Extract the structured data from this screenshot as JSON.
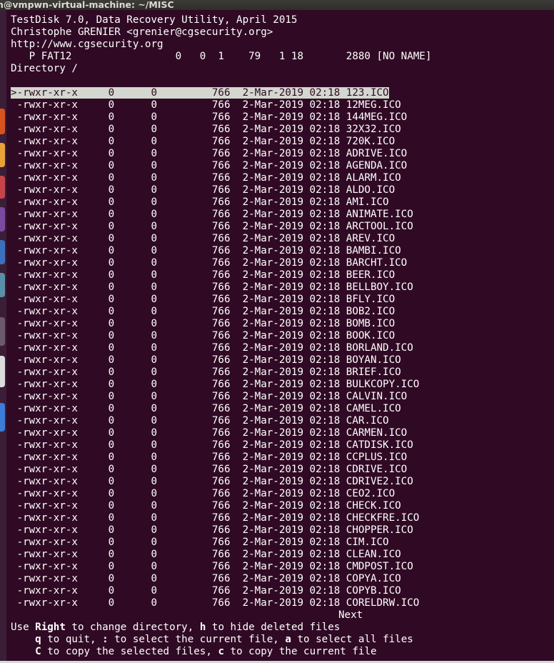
{
  "window": {
    "title": "n@vmpwn-virtual-machine: ~/MISC"
  },
  "header": {
    "line1": "TestDisk 7.0, Data Recovery Utility, April 2015",
    "line2": "Christophe GRENIER <grenier@cgsecurity.org>",
    "line3": "http://www.cgsecurity.org",
    "partition": "   P FAT12                 0   0  1    79   1 18       2880 [NO NAME]",
    "directory": "Directory /"
  },
  "files": [
    {
      "perm": "-rwxr-xr-x",
      "uid": "0",
      "gid": "0",
      "size": "766",
      "date": "2-Mar-2019 02:18",
      "name": "123.ICO"
    },
    {
      "perm": "-rwxr-xr-x",
      "uid": "0",
      "gid": "0",
      "size": "766",
      "date": "2-Mar-2019 02:18",
      "name": "12MEG.ICO"
    },
    {
      "perm": "-rwxr-xr-x",
      "uid": "0",
      "gid": "0",
      "size": "766",
      "date": "2-Mar-2019 02:18",
      "name": "144MEG.ICO"
    },
    {
      "perm": "-rwxr-xr-x",
      "uid": "0",
      "gid": "0",
      "size": "766",
      "date": "2-Mar-2019 02:18",
      "name": "32X32.ICO"
    },
    {
      "perm": "-rwxr-xr-x",
      "uid": "0",
      "gid": "0",
      "size": "766",
      "date": "2-Mar-2019 02:18",
      "name": "720K.ICO"
    },
    {
      "perm": "-rwxr-xr-x",
      "uid": "0",
      "gid": "0",
      "size": "766",
      "date": "2-Mar-2019 02:18",
      "name": "ADRIVE.ICO"
    },
    {
      "perm": "-rwxr-xr-x",
      "uid": "0",
      "gid": "0",
      "size": "766",
      "date": "2-Mar-2019 02:18",
      "name": "AGENDA.ICO"
    },
    {
      "perm": "-rwxr-xr-x",
      "uid": "0",
      "gid": "0",
      "size": "766",
      "date": "2-Mar-2019 02:18",
      "name": "ALARM.ICO"
    },
    {
      "perm": "-rwxr-xr-x",
      "uid": "0",
      "gid": "0",
      "size": "766",
      "date": "2-Mar-2019 02:18",
      "name": "ALDO.ICO"
    },
    {
      "perm": "-rwxr-xr-x",
      "uid": "0",
      "gid": "0",
      "size": "766",
      "date": "2-Mar-2019 02:18",
      "name": "AMI.ICO"
    },
    {
      "perm": "-rwxr-xr-x",
      "uid": "0",
      "gid": "0",
      "size": "766",
      "date": "2-Mar-2019 02:18",
      "name": "ANIMATE.ICO"
    },
    {
      "perm": "-rwxr-xr-x",
      "uid": "0",
      "gid": "0",
      "size": "766",
      "date": "2-Mar-2019 02:18",
      "name": "ARCTOOL.ICO"
    },
    {
      "perm": "-rwxr-xr-x",
      "uid": "0",
      "gid": "0",
      "size": "766",
      "date": "2-Mar-2019 02:18",
      "name": "AREV.ICO"
    },
    {
      "perm": "-rwxr-xr-x",
      "uid": "0",
      "gid": "0",
      "size": "766",
      "date": "2-Mar-2019 02:18",
      "name": "BAMBI.ICO"
    },
    {
      "perm": "-rwxr-xr-x",
      "uid": "0",
      "gid": "0",
      "size": "766",
      "date": "2-Mar-2019 02:18",
      "name": "BARCHT.ICO"
    },
    {
      "perm": "-rwxr-xr-x",
      "uid": "0",
      "gid": "0",
      "size": "766",
      "date": "2-Mar-2019 02:18",
      "name": "BEER.ICO"
    },
    {
      "perm": "-rwxr-xr-x",
      "uid": "0",
      "gid": "0",
      "size": "766",
      "date": "2-Mar-2019 02:18",
      "name": "BELLBOY.ICO"
    },
    {
      "perm": "-rwxr-xr-x",
      "uid": "0",
      "gid": "0",
      "size": "766",
      "date": "2-Mar-2019 02:18",
      "name": "BFLY.ICO"
    },
    {
      "perm": "-rwxr-xr-x",
      "uid": "0",
      "gid": "0",
      "size": "766",
      "date": "2-Mar-2019 02:18",
      "name": "BOB2.ICO"
    },
    {
      "perm": "-rwxr-xr-x",
      "uid": "0",
      "gid": "0",
      "size": "766",
      "date": "2-Mar-2019 02:18",
      "name": "BOMB.ICO"
    },
    {
      "perm": "-rwxr-xr-x",
      "uid": "0",
      "gid": "0",
      "size": "766",
      "date": "2-Mar-2019 02:18",
      "name": "BOOK.ICO"
    },
    {
      "perm": "-rwxr-xr-x",
      "uid": "0",
      "gid": "0",
      "size": "766",
      "date": "2-Mar-2019 02:18",
      "name": "BORLAND.ICO"
    },
    {
      "perm": "-rwxr-xr-x",
      "uid": "0",
      "gid": "0",
      "size": "766",
      "date": "2-Mar-2019 02:18",
      "name": "BOYAN.ICO"
    },
    {
      "perm": "-rwxr-xr-x",
      "uid": "0",
      "gid": "0",
      "size": "766",
      "date": "2-Mar-2019 02:18",
      "name": "BRIEF.ICO"
    },
    {
      "perm": "-rwxr-xr-x",
      "uid": "0",
      "gid": "0",
      "size": "766",
      "date": "2-Mar-2019 02:18",
      "name": "BULKCOPY.ICO"
    },
    {
      "perm": "-rwxr-xr-x",
      "uid": "0",
      "gid": "0",
      "size": "766",
      "date": "2-Mar-2019 02:18",
      "name": "CALVIN.ICO"
    },
    {
      "perm": "-rwxr-xr-x",
      "uid": "0",
      "gid": "0",
      "size": "766",
      "date": "2-Mar-2019 02:18",
      "name": "CAMEL.ICO"
    },
    {
      "perm": "-rwxr-xr-x",
      "uid": "0",
      "gid": "0",
      "size": "766",
      "date": "2-Mar-2019 02:18",
      "name": "CAR.ICO"
    },
    {
      "perm": "-rwxr-xr-x",
      "uid": "0",
      "gid": "0",
      "size": "766",
      "date": "2-Mar-2019 02:18",
      "name": "CARMEN.ICO"
    },
    {
      "perm": "-rwxr-xr-x",
      "uid": "0",
      "gid": "0",
      "size": "766",
      "date": "2-Mar-2019 02:18",
      "name": "CATDISK.ICO"
    },
    {
      "perm": "-rwxr-xr-x",
      "uid": "0",
      "gid": "0",
      "size": "766",
      "date": "2-Mar-2019 02:18",
      "name": "CCPLUS.ICO"
    },
    {
      "perm": "-rwxr-xr-x",
      "uid": "0",
      "gid": "0",
      "size": "766",
      "date": "2-Mar-2019 02:18",
      "name": "CDRIVE.ICO"
    },
    {
      "perm": "-rwxr-xr-x",
      "uid": "0",
      "gid": "0",
      "size": "766",
      "date": "2-Mar-2019 02:18",
      "name": "CDRIVE2.ICO"
    },
    {
      "perm": "-rwxr-xr-x",
      "uid": "0",
      "gid": "0",
      "size": "766",
      "date": "2-Mar-2019 02:18",
      "name": "CEO2.ICO"
    },
    {
      "perm": "-rwxr-xr-x",
      "uid": "0",
      "gid": "0",
      "size": "766",
      "date": "2-Mar-2019 02:18",
      "name": "CHECK.ICO"
    },
    {
      "perm": "-rwxr-xr-x",
      "uid": "0",
      "gid": "0",
      "size": "766",
      "date": "2-Mar-2019 02:18",
      "name": "CHECKFRE.ICO"
    },
    {
      "perm": "-rwxr-xr-x",
      "uid": "0",
      "gid": "0",
      "size": "766",
      "date": "2-Mar-2019 02:18",
      "name": "CHOPPER.ICO"
    },
    {
      "perm": "-rwxr-xr-x",
      "uid": "0",
      "gid": "0",
      "size": "766",
      "date": "2-Mar-2019 02:18",
      "name": "CIM.ICO"
    },
    {
      "perm": "-rwxr-xr-x",
      "uid": "0",
      "gid": "0",
      "size": "766",
      "date": "2-Mar-2019 02:18",
      "name": "CLEAN.ICO"
    },
    {
      "perm": "-rwxr-xr-x",
      "uid": "0",
      "gid": "0",
      "size": "766",
      "date": "2-Mar-2019 02:18",
      "name": "CMDPOST.ICO"
    },
    {
      "perm": "-rwxr-xr-x",
      "uid": "0",
      "gid": "0",
      "size": "766",
      "date": "2-Mar-2019 02:18",
      "name": "COPYA.ICO"
    },
    {
      "perm": "-rwxr-xr-x",
      "uid": "0",
      "gid": "0",
      "size": "766",
      "date": "2-Mar-2019 02:18",
      "name": "COPYB.ICO"
    },
    {
      "perm": "-rwxr-xr-x",
      "uid": "0",
      "gid": "0",
      "size": "766",
      "date": "2-Mar-2019 02:18",
      "name": "CORELDRW.ICO"
    }
  ],
  "selected_index": 0,
  "selection_marker": ">",
  "next_label": "Next",
  "help": {
    "line1": [
      {
        "t": "Use ",
        "b": false
      },
      {
        "t": "Right",
        "b": true
      },
      {
        "t": " to change directory, ",
        "b": false
      },
      {
        "t": "h",
        "b": true
      },
      {
        "t": " to hide deleted files",
        "b": false
      }
    ],
    "line2": [
      {
        "t": "    ",
        "b": false
      },
      {
        "t": "q",
        "b": true
      },
      {
        "t": " to quit, ",
        "b": false
      },
      {
        "t": ":",
        "b": true
      },
      {
        "t": " to select the current file, ",
        "b": false
      },
      {
        "t": "a",
        "b": true
      },
      {
        "t": " to select all files",
        "b": false
      }
    ],
    "line3": [
      {
        "t": "    ",
        "b": false
      },
      {
        "t": "C",
        "b": true
      },
      {
        "t": " to copy the selected files, ",
        "b": false
      },
      {
        "t": "c",
        "b": true
      },
      {
        "t": " to copy the current file",
        "b": false
      }
    ]
  },
  "colors": {
    "terminal_bg": "#300a24",
    "terminal_fg": "#ffffff",
    "highlight_bg": "#d3d7cf",
    "highlight_fg": "#300a24"
  },
  "launcher_icons": [
    "app-icon-orange",
    "app-icon-yellow",
    "app-icon-red",
    "app-icon-purple",
    "app-icon-blue",
    "app-icon-teal",
    "app-icon-gray",
    "app-icon-blue-2"
  ]
}
